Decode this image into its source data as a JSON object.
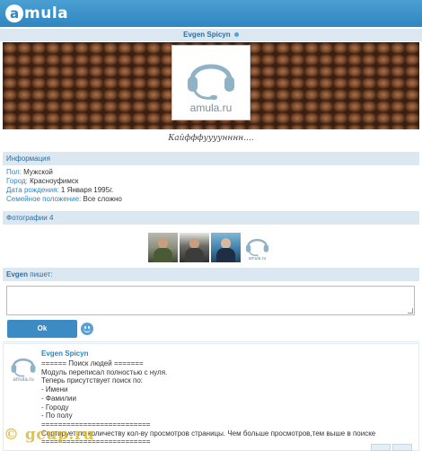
{
  "header": {
    "logo_letter": "a",
    "logo_text": "mula"
  },
  "profile": {
    "name": "Evgen Spicyn",
    "avatar_label": "amula.ru",
    "status": "Кайфффуууунннн...."
  },
  "info": {
    "title": "Информация",
    "fields": [
      {
        "label": "Пол:",
        "value": "Мужской"
      },
      {
        "label": "Город:",
        "value": "Красноуфимск"
      },
      {
        "label": "Дата рождения:",
        "value": "1 Января 1995г."
      },
      {
        "label": "Семейное положение:",
        "value": "Все сложно"
      }
    ]
  },
  "photos": {
    "title": "Фотографии 4",
    "placeholder_label": "amula.ru"
  },
  "compose": {
    "author": "Evgen",
    "suffix": "пишет:",
    "input_value": "",
    "ok_label": "Ok"
  },
  "post": {
    "author": "Evgen Spicyn",
    "avatar_label": "amula.ru",
    "text": "====== Поиск людей =======\nМодуль переписал полностью с нуля.\nТеперь присутствует поиск по:\n- Имени\n- Фамилии\n- Городу\n- По полу\n==========================\nСортирует по количеству кол-ву просмотров страницы. Чем больше просмотров,тем выше в поиске\n=========================="
  },
  "watermark": "© gcup.ru",
  "colors": {
    "accent": "#2f86c0",
    "header_bar": "#3d93c9",
    "section_bg": "#dbe7f1",
    "watermark": "#d6b018"
  }
}
